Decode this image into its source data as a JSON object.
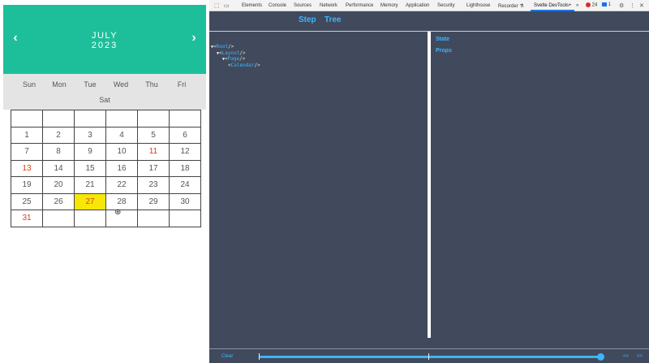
{
  "calendar": {
    "month": "JULY",
    "year": "2023",
    "prev_icon": "chevron-left-icon",
    "next_icon": "chevron-right-icon",
    "prev_glyph": "‹",
    "next_glyph": "›",
    "weekdays": [
      "Sun",
      "Mon",
      "Tue",
      "Wed",
      "Thu",
      "Fri",
      "Sat"
    ],
    "days": [
      [
        "",
        "",
        "",
        "",
        "",
        ""
      ],
      [
        "1",
        "2",
        "3",
        "4",
        "5",
        "6"
      ],
      [
        "7",
        "8",
        "9",
        "10",
        "11",
        "12"
      ],
      [
        "13",
        "14",
        "15",
        "16",
        "17",
        "18"
      ],
      [
        "19",
        "20",
        "21",
        "22",
        "23",
        "24"
      ],
      [
        "25",
        "26",
        "27",
        "28",
        "29",
        "30"
      ],
      [
        "31",
        "",
        "",
        "",
        "",
        ""
      ]
    ],
    "extra_day": "",
    "highlighted_days": [
      "11",
      "13",
      "31"
    ],
    "selected_day": "27",
    "colors": {
      "header": "#1dbf9b",
      "highlight_text": "#d84315",
      "selected_bg": "#f7e707"
    }
  },
  "devtools": {
    "tabs": [
      "Elements",
      "Console",
      "Sources",
      "Network",
      "Performance",
      "Memory",
      "Application",
      "Security",
      "Lighthouse",
      "Recorder ⚗",
      "Svelte DevTools+"
    ],
    "active_tab": "Svelte DevTools+",
    "more_tabs": "»",
    "error_count": "24",
    "message_count": "1",
    "icons": {
      "inspect": "inspect-icon",
      "device": "device-toggle-icon",
      "settings": "gear-icon",
      "menu": "kebab-menu-icon",
      "close": "close-icon"
    },
    "svelte": {
      "nav": [
        "Step",
        "Tree"
      ],
      "tree": [
        {
          "name": "Root",
          "depth": 0
        },
        {
          "name": "Layout",
          "depth": 1
        },
        {
          "name": "Page",
          "depth": 2
        },
        {
          "name": "Calendar",
          "depth": 3
        }
      ],
      "state_label": "State",
      "props_label": "Props",
      "clear_label": "Clear",
      "prev_label": "<<",
      "next_label": ">>",
      "accent": "#40b3ff",
      "background": "#404a5c"
    }
  }
}
